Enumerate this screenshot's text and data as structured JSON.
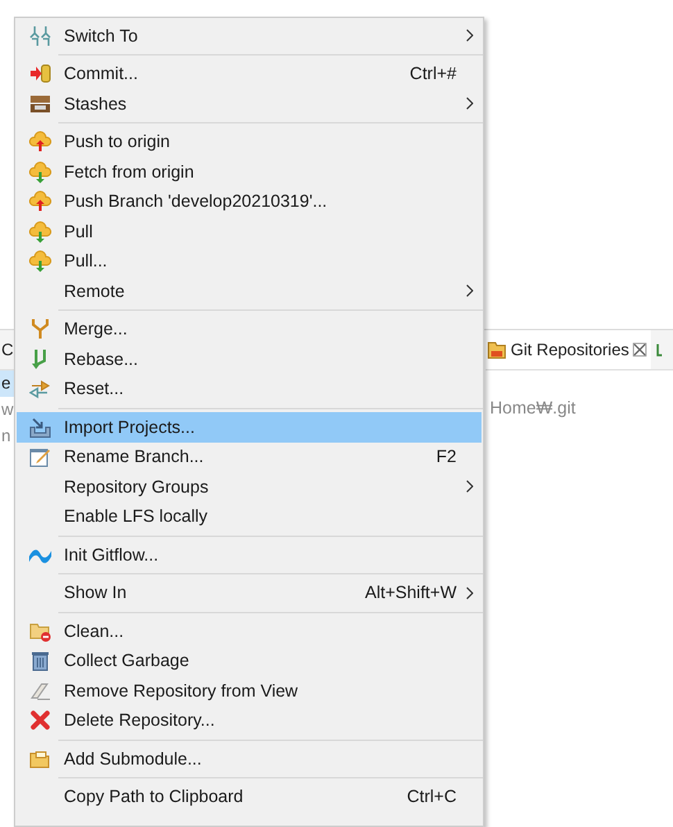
{
  "background": {
    "left_fragments": [
      {
        "text": "C",
        "selected": false
      },
      {
        "text": "e",
        "selected": true
      },
      {
        "text": "w",
        "selected": false
      },
      {
        "text": "n",
        "selected": false
      }
    ],
    "tab": {
      "label": "Git Repositories"
    },
    "path_text": "Home₩.git"
  },
  "menu": {
    "items": [
      {
        "kind": "item",
        "label": "Switch To",
        "submenu": true,
        "selected": false
      },
      {
        "kind": "separator"
      },
      {
        "kind": "item",
        "label": "Commit...",
        "shortcut": "Ctrl+#",
        "submenu": false,
        "selected": false
      },
      {
        "kind": "item",
        "label": "Stashes",
        "submenu": true,
        "selected": false
      },
      {
        "kind": "separator"
      },
      {
        "kind": "item",
        "label": "Push to origin",
        "submenu": false,
        "selected": false
      },
      {
        "kind": "item",
        "label": "Fetch from origin",
        "submenu": false,
        "selected": false
      },
      {
        "kind": "item",
        "label": "Push Branch 'develop20210319'...",
        "submenu": false,
        "selected": false
      },
      {
        "kind": "item",
        "label": "Pull",
        "submenu": false,
        "selected": false
      },
      {
        "kind": "item",
        "label": "Pull...",
        "submenu": false,
        "selected": false
      },
      {
        "kind": "item",
        "label": "Remote",
        "submenu": true,
        "selected": false
      },
      {
        "kind": "separator"
      },
      {
        "kind": "item",
        "label": "Merge...",
        "submenu": false,
        "selected": false
      },
      {
        "kind": "item",
        "label": "Rebase...",
        "submenu": false,
        "selected": false
      },
      {
        "kind": "item",
        "label": "Reset...",
        "submenu": false,
        "selected": false
      },
      {
        "kind": "separator"
      },
      {
        "kind": "item",
        "label": "Import Projects...",
        "submenu": false,
        "selected": true
      },
      {
        "kind": "item",
        "label": "Rename Branch...",
        "shortcut": "F2",
        "submenu": false,
        "selected": false
      },
      {
        "kind": "item",
        "label": "Repository Groups",
        "submenu": true,
        "selected": false
      },
      {
        "kind": "item",
        "label": "Enable LFS locally",
        "submenu": false,
        "selected": false
      },
      {
        "kind": "separator"
      },
      {
        "kind": "item",
        "label": "Init Gitflow...",
        "submenu": false,
        "selected": false
      },
      {
        "kind": "separator"
      },
      {
        "kind": "item",
        "label": "Show In",
        "shortcut": "Alt+Shift+W",
        "submenu": true,
        "selected": false
      },
      {
        "kind": "separator"
      },
      {
        "kind": "item",
        "label": "Clean...",
        "submenu": false,
        "selected": false
      },
      {
        "kind": "item",
        "label": "Collect Garbage",
        "submenu": false,
        "selected": false
      },
      {
        "kind": "item",
        "label": "Remove Repository from View",
        "submenu": false,
        "selected": false
      },
      {
        "kind": "item",
        "label": "Delete Repository...",
        "submenu": false,
        "selected": false
      },
      {
        "kind": "separator"
      },
      {
        "kind": "item",
        "label": "Add Submodule...",
        "submenu": false,
        "selected": false
      },
      {
        "kind": "separator"
      },
      {
        "kind": "item",
        "label": "Copy Path to Clipboard",
        "shortcut": "Ctrl+C",
        "submenu": false,
        "selected": false
      }
    ]
  }
}
